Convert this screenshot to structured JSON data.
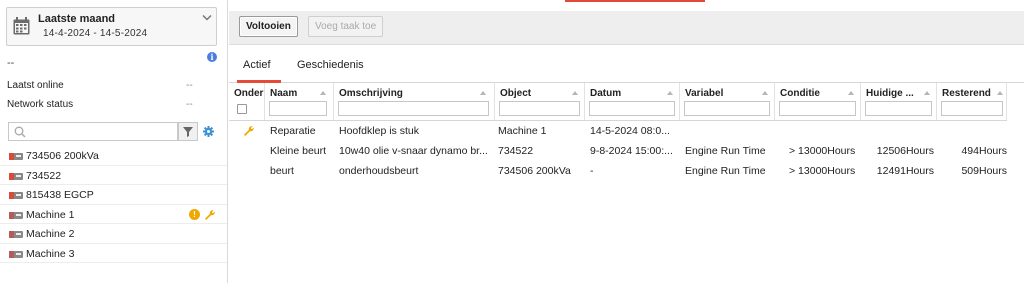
{
  "period": {
    "title": "Laatste maand",
    "range": "14-4-2024 - 14-5-2024"
  },
  "sidebar": {
    "placeholder_line": "--",
    "info_icon_text": "i",
    "last_online": {
      "label": "Laatst online",
      "value": "--"
    },
    "network_status": {
      "label": "Network status",
      "value": "--"
    },
    "search": {
      "placeholder": ""
    },
    "assets": [
      {
        "label": "734506 200kVa"
      },
      {
        "label": "734522"
      },
      {
        "label": "815438 EGCP"
      },
      {
        "label": "Machine 1",
        "badge": "!"
      },
      {
        "label": "Machine 2"
      },
      {
        "label": "Machine 3"
      }
    ]
  },
  "toolbar": {
    "done_label": "Voltooien",
    "add_task_label": "Voeg taak toe"
  },
  "tabs": {
    "active": "Actief",
    "history": "Geschiedenis"
  },
  "table": {
    "headers": {
      "onder": "Onder",
      "naam": "Naam",
      "omschrijving": "Omschrijving",
      "object": "Object",
      "datum": "Datum",
      "variabel": "Variabel",
      "conditie": "Conditie",
      "huidige": "Huidige ...",
      "resterend": "Resterend"
    },
    "rows": [
      {
        "naam": "Reparatie",
        "omschrijving": "Hoofdklep is stuk",
        "object": "Machine 1",
        "datum": "14-5-2024 08:0...",
        "variabel": "",
        "conditie": "",
        "huidige": "",
        "resterend": ""
      },
      {
        "naam": "Kleine beurt",
        "omschrijving": "10w40 olie v-snaar dynamo br...",
        "object": "734522",
        "datum": "9-8-2024 15:00:...",
        "variabel": "Engine Run Time",
        "conditie": "> 13000Hours",
        "huidige": "12506Hours",
        "resterend": "494Hours"
      },
      {
        "naam": "beurt",
        "omschrijving": "onderhoudsbeurt",
        "object": "734506 200kVa",
        "datum": "-",
        "variabel": "Engine Run Time",
        "conditie": "> 13000Hours",
        "huidige": "12491Hours",
        "resterend": "509Hours"
      }
    ]
  },
  "colors": {
    "accent": "#e84a3a",
    "info": "#4a7de0",
    "warning": "#f0a800",
    "settings": "#3a8fd6"
  }
}
